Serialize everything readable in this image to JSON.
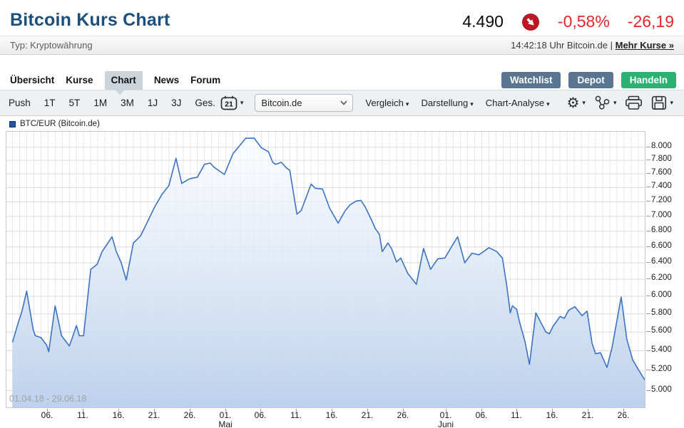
{
  "header": {
    "title": "Bitcoin Kurs Chart",
    "price": "4.490",
    "change_pct": "-0,58%",
    "change_abs": "-26,19",
    "trend_icon": "arrow-down-right-circle",
    "type_label": "Typ: Kryptowährung",
    "time_info": "14:42:18 Uhr Bitcoin.de |",
    "more_link": "Mehr Kurse »",
    "red": "#e8242b",
    "trend_red": "#bb1724",
    "title_blue": "#1b4f7d"
  },
  "nav": {
    "tabs": [
      {
        "label": "Übersicht",
        "active": false
      },
      {
        "label": "Kurse",
        "active": false
      },
      {
        "label": "Chart",
        "active": true
      },
      {
        "label": "News",
        "active": false
      },
      {
        "label": "Forum",
        "active": false
      }
    ],
    "buttons": [
      {
        "label": "Watchlist",
        "color": "#5a7590"
      },
      {
        "label": "Depot",
        "color": "#5a7590"
      },
      {
        "label": "Handeln",
        "color": "#2bb273"
      }
    ]
  },
  "toolbar": {
    "ranges": [
      "Push",
      "1T",
      "5T",
      "1M",
      "3M",
      "1J",
      "3J",
      "Ges."
    ],
    "calendar_day": "21",
    "exchange_select": "Bitcoin.de",
    "menus": [
      "Vergleich",
      "Darstellung",
      "Chart-Analyse"
    ],
    "icons": [
      "calendar-icon",
      "gear-icon",
      "share-icon",
      "printer-icon",
      "save-icon"
    ],
    "caret": "▾"
  },
  "legend": {
    "label": "BTC/EUR (Bitcoin.de)",
    "color": "#2253a6"
  },
  "watermark": "01.04.18 - 29.06.18",
  "chart_data": {
    "type": "area",
    "title": "BTC/EUR (Bitcoin.de)",
    "x_axis": {
      "start": "01.04.18",
      "end": "29.06.18",
      "unit": "days since 01.04.2018"
    },
    "y_scale": "log",
    "ylim": [
      4900,
      8200
    ],
    "grid": true,
    "legend_position": "top-left",
    "colors": {
      "line": "#3b73c4",
      "fill_top": "#fbfcfe",
      "fill_bottom": "#b9cfec"
    },
    "y_ticks": [
      5000,
      5200,
      5400,
      5600,
      5800,
      6000,
      6200,
      6400,
      6600,
      6800,
      7000,
      7200,
      7400,
      7600,
      7800,
      8000
    ],
    "y_tick_labels": [
      "5.000",
      "5.200",
      "5.400",
      "5.600",
      "5.800",
      "6.000",
      "6.200",
      "6.400",
      "6.600",
      "6.800",
      "7.000",
      "7.200",
      "7.400",
      "7.600",
      "7.800",
      "8.000"
    ],
    "x_ticks": [
      {
        "day": 5,
        "label": "06."
      },
      {
        "day": 10,
        "label": "11."
      },
      {
        "day": 15,
        "label": "16."
      },
      {
        "day": 20,
        "label": "21."
      },
      {
        "day": 25,
        "label": "26."
      },
      {
        "day": 30,
        "label": "01.",
        "sub": "Mai"
      },
      {
        "day": 35,
        "label": "06."
      },
      {
        "day": 40,
        "label": "11."
      },
      {
        "day": 45,
        "label": "16."
      },
      {
        "day": 50,
        "label": "21."
      },
      {
        "day": 55,
        "label": "26."
      },
      {
        "day": 61,
        "label": "01.",
        "sub": "Juni"
      },
      {
        "day": 66,
        "label": "06."
      },
      {
        "day": 71,
        "label": "11."
      },
      {
        "day": 76,
        "label": "16."
      },
      {
        "day": 81,
        "label": "21."
      },
      {
        "day": 86,
        "label": "26."
      }
    ],
    "points": [
      [
        0,
        5490
      ],
      [
        0.8,
        5700
      ],
      [
        1.3,
        5820
      ],
      [
        2,
        6060
      ],
      [
        2.9,
        5630
      ],
      [
        3.2,
        5560
      ],
      [
        4,
        5540
      ],
      [
        4.8,
        5460
      ],
      [
        5.1,
        5390
      ],
      [
        6,
        5890
      ],
      [
        6.9,
        5560
      ],
      [
        8,
        5450
      ],
      [
        9,
        5670
      ],
      [
        9.4,
        5560
      ],
      [
        10,
        5560
      ],
      [
        11,
        6320
      ],
      [
        11.9,
        6380
      ],
      [
        12.6,
        6540
      ],
      [
        13.2,
        6620
      ],
      [
        14,
        6730
      ],
      [
        14.6,
        6540
      ],
      [
        15.3,
        6400
      ],
      [
        16,
        6190
      ],
      [
        17,
        6650
      ],
      [
        18,
        6740
      ],
      [
        19,
        6930
      ],
      [
        20,
        7130
      ],
      [
        21,
        7300
      ],
      [
        22,
        7430
      ],
      [
        23,
        7830
      ],
      [
        23.8,
        7460
      ],
      [
        24.6,
        7510
      ],
      [
        25,
        7530
      ],
      [
        26,
        7550
      ],
      [
        27,
        7740
      ],
      [
        27.8,
        7760
      ],
      [
        28.3,
        7700
      ],
      [
        29.8,
        7590
      ],
      [
        31,
        7900
      ],
      [
        32.8,
        8140
      ],
      [
        34,
        8140
      ],
      [
        35,
        7990
      ],
      [
        36,
        7930
      ],
      [
        36.6,
        7770
      ],
      [
        37,
        7740
      ],
      [
        37.8,
        7770
      ],
      [
        38.5,
        7690
      ],
      [
        39,
        7650
      ],
      [
        40,
        7030
      ],
      [
        40.6,
        7080
      ],
      [
        42,
        7450
      ],
      [
        42.6,
        7390
      ],
      [
        43.6,
        7380
      ],
      [
        44.6,
        7110
      ],
      [
        45.8,
        6910
      ],
      [
        46.8,
        7080
      ],
      [
        47.5,
        7160
      ],
      [
        48.3,
        7210
      ],
      [
        49,
        7220
      ],
      [
        49.6,
        7130
      ],
      [
        50.5,
        6950
      ],
      [
        51,
        6840
      ],
      [
        51.6,
        6760
      ],
      [
        52,
        6540
      ],
      [
        52.8,
        6650
      ],
      [
        53.3,
        6580
      ],
      [
        54,
        6410
      ],
      [
        54.6,
        6460
      ],
      [
        55.6,
        6270
      ],
      [
        56.8,
        6140
      ],
      [
        57.8,
        6580
      ],
      [
        58.8,
        6320
      ],
      [
        59.8,
        6450
      ],
      [
        60.8,
        6460
      ],
      [
        61.8,
        6610
      ],
      [
        62.6,
        6730
      ],
      [
        63.6,
        6400
      ],
      [
        64.6,
        6520
      ],
      [
        65.6,
        6500
      ],
      [
        67,
        6590
      ],
      [
        68.1,
        6540
      ],
      [
        68.9,
        6460
      ],
      [
        69.5,
        6130
      ],
      [
        70,
        5810
      ],
      [
        70.3,
        5890
      ],
      [
        70.9,
        5850
      ],
      [
        71.3,
        5710
      ],
      [
        72.1,
        5490
      ],
      [
        72.7,
        5260
      ],
      [
        73.6,
        5810
      ],
      [
        75,
        5600
      ],
      [
        75.5,
        5580
      ],
      [
        76,
        5660
      ],
      [
        77,
        5770
      ],
      [
        77.6,
        5750
      ],
      [
        78.2,
        5840
      ],
      [
        79.1,
        5880
      ],
      [
        80.1,
        5780
      ],
      [
        80.8,
        5830
      ],
      [
        81.5,
        5480
      ],
      [
        82,
        5370
      ],
      [
        82.7,
        5380
      ],
      [
        83.6,
        5230
      ],
      [
        84.3,
        5430
      ],
      [
        85.6,
        5990
      ],
      [
        86.4,
        5520
      ],
      [
        87.2,
        5310
      ],
      [
        88,
        5210
      ],
      [
        88.7,
        5130
      ],
      [
        89,
        5100
      ]
    ]
  }
}
